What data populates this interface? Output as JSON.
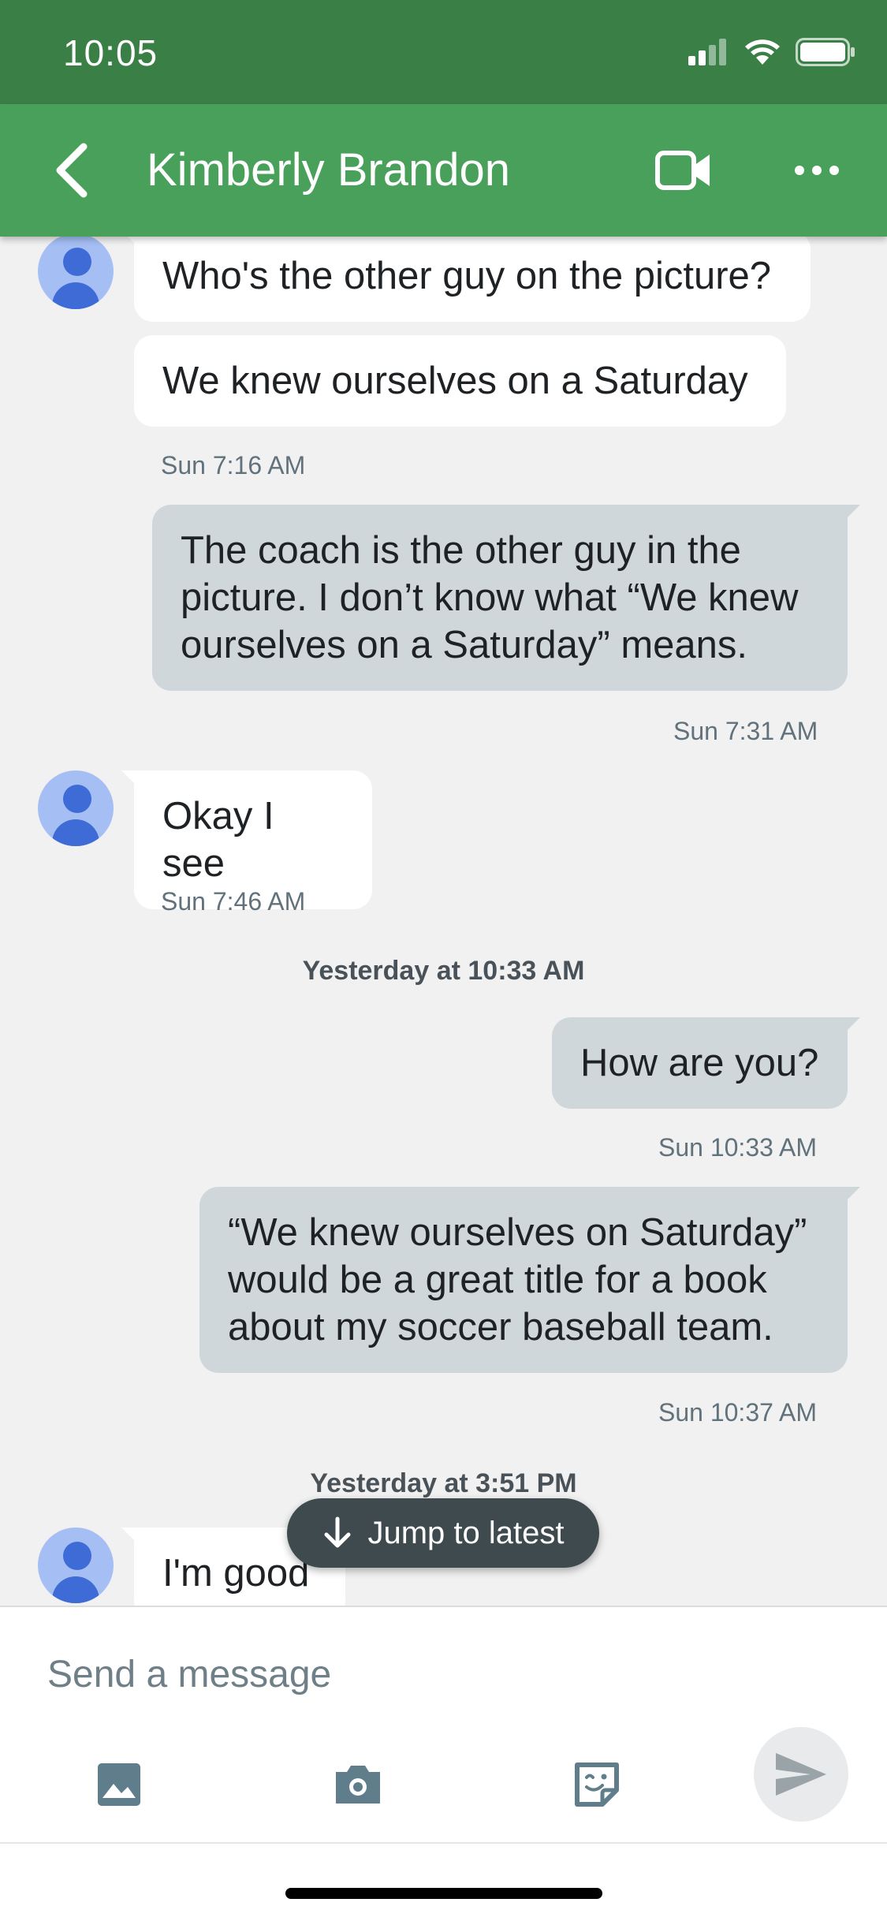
{
  "status_bar": {
    "time": "10:05"
  },
  "header": {
    "contact_name": "Kimberly Brandon"
  },
  "messages": [
    {
      "text": "Who's the other guy on the picture?"
    },
    {
      "text": "We knew ourselves on a Saturday"
    },
    {
      "timestamp": "Sun 7:16 AM"
    },
    {
      "text": "The coach is the other guy in the picture. I don’t know what “We knew ourselves on a Saturday” means."
    },
    {
      "timestamp": "Sun 7:31 AM"
    },
    {
      "text": "Okay I see"
    },
    {
      "timestamp": "Sun 7:46 AM"
    },
    {
      "day_separator": "Yesterday at 10:33 AM"
    },
    {
      "text": "How are you?"
    },
    {
      "timestamp": "Sun 10:33 AM"
    },
    {
      "text": "“We knew ourselves on Saturday” would be a great title for a book about my soccer baseball team."
    },
    {
      "timestamp": "Sun 10:37 AM"
    },
    {
      "day_separator": "Yesterday at 3:51 PM"
    },
    {
      "text": "I'm good"
    }
  ],
  "jump_button": {
    "label": "Jump to latest"
  },
  "composer": {
    "placeholder": "Send a message",
    "tools": [
      "image-icon",
      "camera-icon",
      "sticker-icon",
      "send-icon"
    ]
  },
  "colors": {
    "status_bar": "#3a8046",
    "header": "#49a05b",
    "incoming_bubble": "#ffffff",
    "outgoing_bubble": "#d0d7db",
    "background": "#f1f1f1",
    "avatar": "#a5bff5"
  }
}
